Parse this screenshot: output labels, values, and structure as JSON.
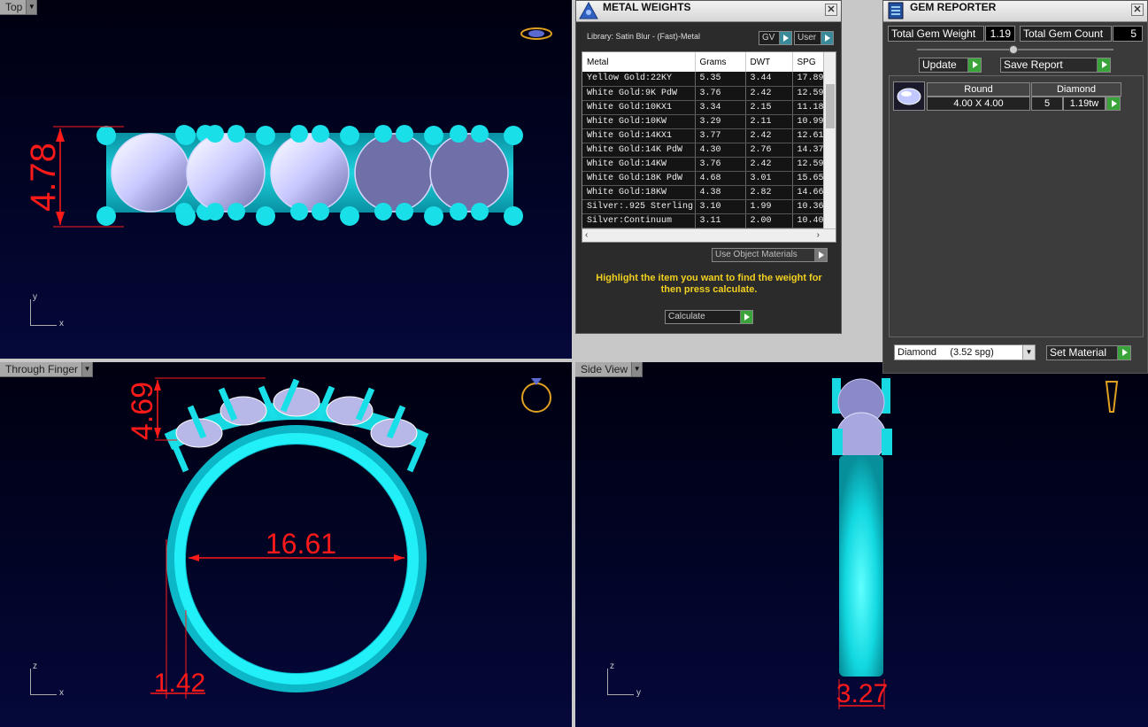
{
  "viewports": {
    "top": {
      "label": "Top",
      "dimension": "4.78",
      "axis_v": "y",
      "axis_h": "x"
    },
    "front": {
      "label": "Through Finger",
      "dim_height": "4.69",
      "dim_inner": "16.61",
      "dim_shank": "1.42",
      "axis_v": "z",
      "axis_h": "x"
    },
    "side": {
      "label": "Side View",
      "dim_width": "3.27",
      "axis_v": "z",
      "axis_h": "y"
    }
  },
  "metal_weights": {
    "title": "METAL WEIGHTS",
    "library": "Library: Satin Blur - (Fast)-Metal",
    "gv_label": "GV",
    "user_label": "User",
    "columns": [
      "Metal",
      "Grams",
      "DWT",
      "SPG"
    ],
    "rows": [
      [
        "Yellow Gold:22KY",
        "5.35",
        "3.44",
        "17.89"
      ],
      [
        "White Gold:9K PdW",
        "3.76",
        "2.42",
        "12.59"
      ],
      [
        "White Gold:10KX1",
        "3.34",
        "2.15",
        "11.18"
      ],
      [
        "White Gold:10KW",
        "3.29",
        "2.11",
        "10.99"
      ],
      [
        "White Gold:14KX1",
        "3.77",
        "2.42",
        "12.61"
      ],
      [
        "White Gold:14K PdW",
        "4.30",
        "2.76",
        "14.37"
      ],
      [
        "White Gold:14KW",
        "3.76",
        "2.42",
        "12.59"
      ],
      [
        "White Gold:18K PdW",
        "4.68",
        "3.01",
        "15.65"
      ],
      [
        "White Gold:18KW",
        "4.38",
        "2.82",
        "14.66"
      ],
      [
        "Silver:.925 Sterling",
        "3.10",
        "1.99",
        "10.36"
      ],
      [
        "Silver:Continuum",
        "3.11",
        "2.00",
        "10.40"
      ]
    ],
    "use_object_materials": "Use Object Materials",
    "instruction": "Highlight the item you want to find the weight for then press calculate.",
    "calculate": "Calculate"
  },
  "gem_reporter": {
    "title": "GEM REPORTER",
    "total_weight_label": "Total Gem Weight",
    "total_weight_value": "1.19",
    "total_count_label": "Total Gem Count",
    "total_count_value": "5",
    "update": "Update",
    "save_report": "Save Report",
    "gem": {
      "shape": "Round",
      "material": "Diamond",
      "size": "4.00 X 4.00",
      "count": "5",
      "weight": "1.19tw"
    },
    "material_select": "Diamond     (3.52 spg)",
    "set_material": "Set Material"
  },
  "colors": {
    "metal": "#19e0e8",
    "dimension": "#ff1a1a",
    "highlight_text": "#f0d020"
  }
}
